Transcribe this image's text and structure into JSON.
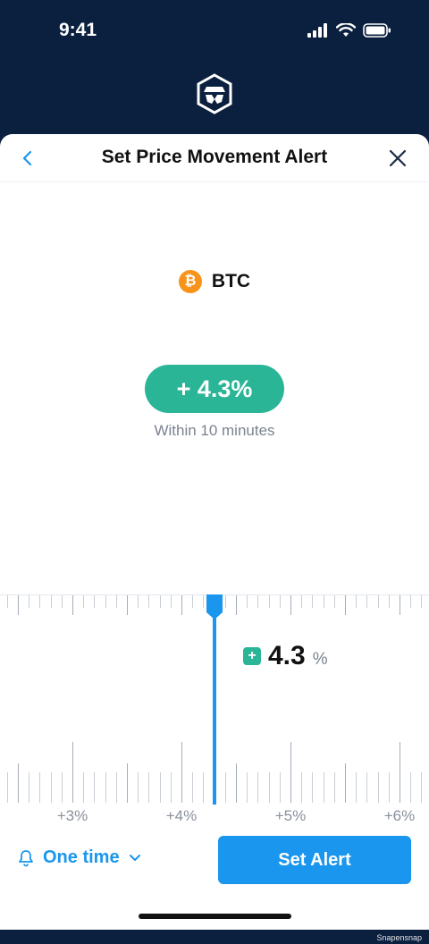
{
  "status_bar": {
    "time": "9:41"
  },
  "nav": {
    "title": "Set Price Movement Alert"
  },
  "asset": {
    "symbol": "BTC",
    "icon_glyph": "₿",
    "icon_color": "#f7931a"
  },
  "movement": {
    "pill_text": "+ 4.3%",
    "timeframe": "Within 10 minutes"
  },
  "ruler": {
    "labels": [
      "+3%",
      "+4%",
      "+5%",
      "+6%"
    ],
    "readout_sign": "+",
    "readout_value": "4.3",
    "readout_unit": "%"
  },
  "footer": {
    "frequency_label": "One time",
    "set_alert_label": "Set Alert"
  },
  "watermark": "Snapensnap",
  "colors": {
    "header_bg": "#0b1f3f",
    "accent_blue": "#1a96ee",
    "accent_green": "#2ab597"
  }
}
